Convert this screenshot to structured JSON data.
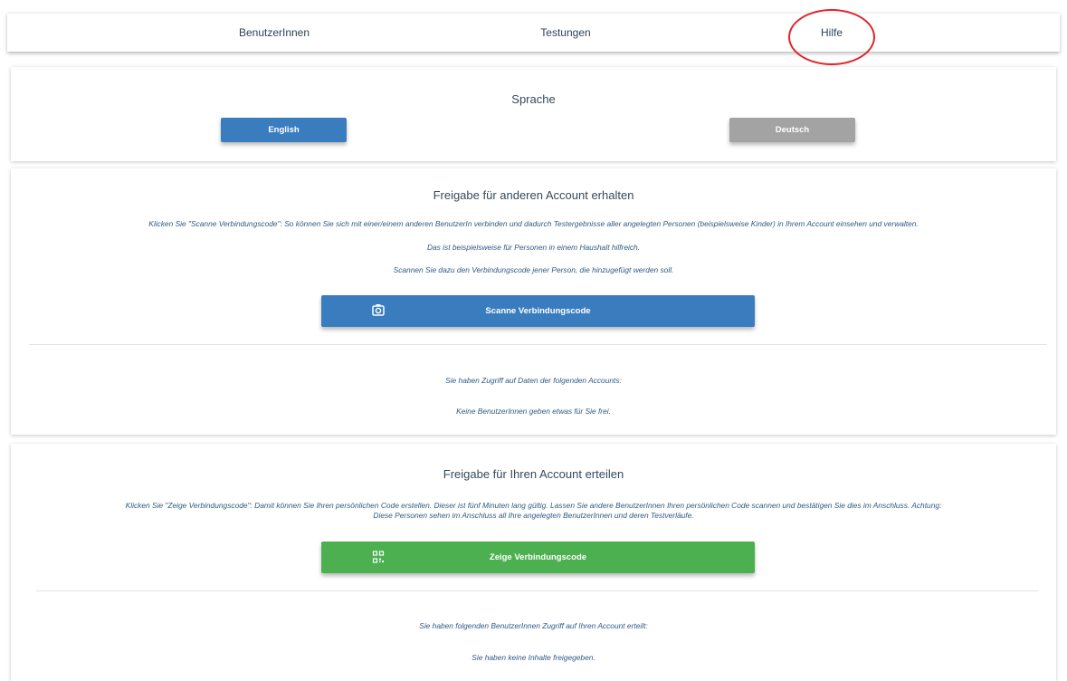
{
  "nav": {
    "items": [
      "BenutzerInnen",
      "Testungen",
      "Hilfe"
    ]
  },
  "language": {
    "title": "Sprache",
    "english_label": "English",
    "deutsch_label": "Deutsch"
  },
  "receive": {
    "title": "Freigabe für anderen Account erhalten",
    "lines": [
      "Klicken Sie \"Scanne Verbindungscode\": So können Sie sich mit einer/einem anderen BenutzerIn verbinden und dadurch Testergebnisse aller angelegten Personen (beispielsweise Kinder) in Ihrem Account einsehen und verwalten.",
      "Das ist beispielsweise für Personen in einem Haushalt hilfreich.",
      "Scannen Sie dazu den Verbindungscode jener Person, die hinzugefügt werden soll."
    ],
    "button_label": "Scanne Verbindungscode",
    "access_heading": "Sie haben Zugriff auf Daten der folgenden Accounts:",
    "access_empty": "Keine BenutzerInnen geben etwas für Sie frei."
  },
  "grant": {
    "title": "Freigabe für Ihren Account erteilen",
    "description_line1": "Klicken Sie \"Zeige Verbindungscode\": Damit können Sie Ihren persönlichen Code erstellen. Dieser ist fünf Minuten lang gültig. Lassen Sie andere BenutzerInnen Ihren persönlichen Code scannen und bestätigen Sie dies im Anschluss. Achtung:",
    "description_line2": "Diese Personen sehen im Anschluss all Ihre angelegten BenutzerInnen und deren Testverläufe.",
    "button_label": "Zeige Verbindungscode",
    "granted_heading": "Sie haben folgenden BenutzerInnen Zugriff auf Ihren Account erteilt:",
    "granted_empty": "Sie haben keine Inhalte freigegeben."
  },
  "colors": {
    "primary_blue": "#3a7dbf",
    "success_green": "#4caf50",
    "inactive_gray": "#a3a3a3",
    "annotation_red": "#e0242a"
  },
  "icons": {
    "scan": "camera-icon",
    "show": "qr-code-icon"
  }
}
